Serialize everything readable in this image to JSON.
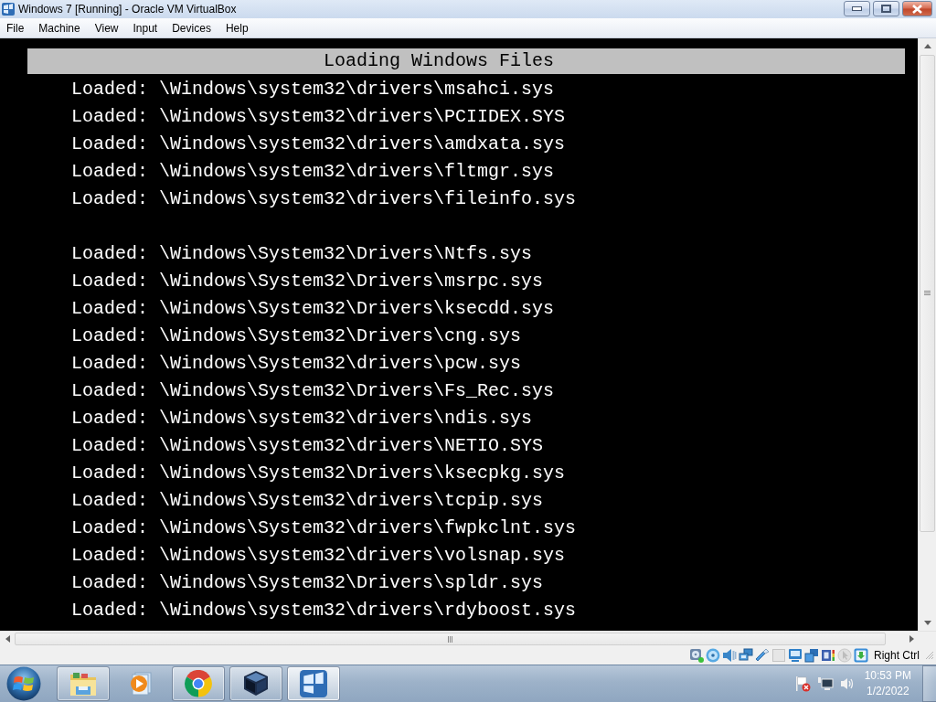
{
  "window": {
    "title": "Windows 7 [Running] - Oracle VM VirtualBox"
  },
  "menu": [
    "File",
    "Machine",
    "View",
    "Input",
    "Devices",
    "Help"
  ],
  "console": {
    "header": "Loading Windows Files",
    "groups": [
      [
        "Loaded: \\Windows\\system32\\drivers\\msahci.sys",
        "Loaded: \\Windows\\system32\\drivers\\PCIIDEX.SYS",
        "Loaded: \\Windows\\system32\\drivers\\amdxata.sys",
        "Loaded: \\Windows\\system32\\drivers\\fltmgr.sys",
        "Loaded: \\Windows\\system32\\drivers\\fileinfo.sys"
      ],
      [
        "Loaded: \\Windows\\System32\\Drivers\\Ntfs.sys",
        "Loaded: \\Windows\\System32\\Drivers\\msrpc.sys",
        "Loaded: \\Windows\\System32\\Drivers\\ksecdd.sys",
        "Loaded: \\Windows\\System32\\Drivers\\cng.sys",
        "Loaded: \\Windows\\System32\\drivers\\pcw.sys",
        "Loaded: \\Windows\\System32\\Drivers\\Fs_Rec.sys",
        "Loaded: \\Windows\\system32\\drivers\\ndis.sys",
        "Loaded: \\Windows\\system32\\drivers\\NETIO.SYS",
        "Loaded: \\Windows\\System32\\Drivers\\ksecpkg.sys",
        "Loaded: \\Windows\\System32\\drivers\\tcpip.sys",
        "Loaded: \\Windows\\System32\\drivers\\fwpkclnt.sys",
        "Loaded: \\Windows\\system32\\drivers\\volsnap.sys",
        "Loaded: \\Windows\\System32\\Drivers\\spldr.sys",
        "Loaded: \\Windows\\system32\\drivers\\rdyboost.sys"
      ]
    ]
  },
  "status_bar": {
    "host_key": "Right Ctrl"
  },
  "taskbar": {
    "apps": [
      {
        "kind": "explorer",
        "running": true,
        "selected": false
      },
      {
        "kind": "media",
        "running": false,
        "selected": false
      },
      {
        "kind": "browser",
        "running": true,
        "selected": false
      },
      {
        "kind": "virtualbox",
        "running": true,
        "selected": false
      },
      {
        "kind": "vm",
        "running": true,
        "selected": true
      }
    ],
    "clock": {
      "time": "10:53 PM",
      "date": "1/2/2022"
    }
  }
}
